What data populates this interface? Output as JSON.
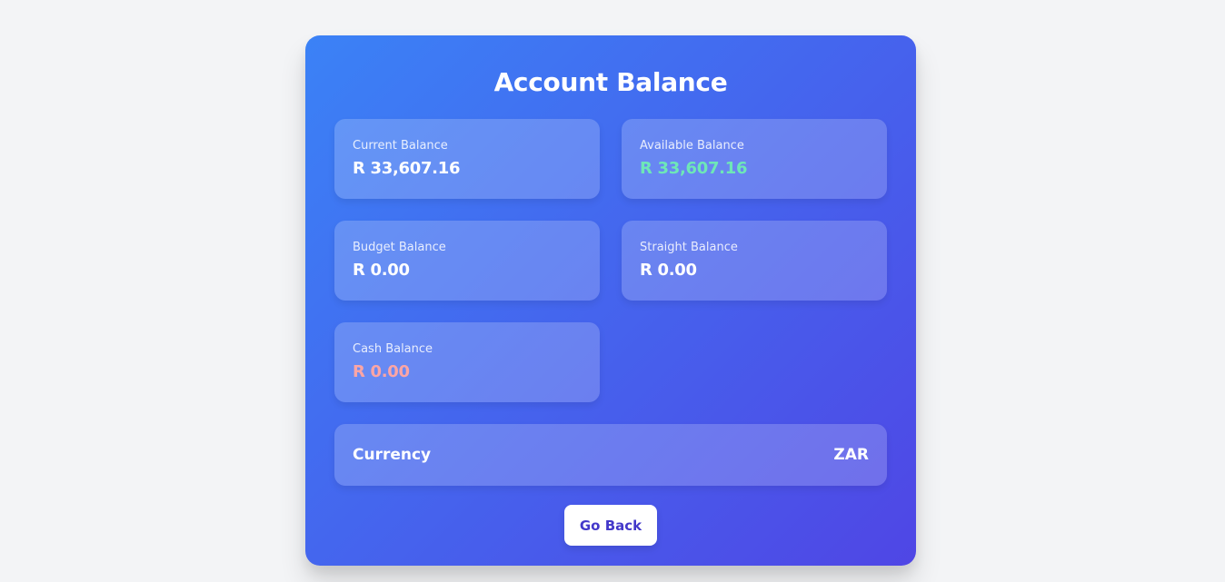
{
  "page": {
    "title": "Account Balance"
  },
  "balances": {
    "current": {
      "label": "Current Balance",
      "value": "R 33,607.16",
      "color": "#ffffff"
    },
    "available": {
      "label": "Available Balance",
      "value": "R 33,607.16",
      "color": "#6ee7b7"
    },
    "budget": {
      "label": "Budget Balance",
      "value": "R 0.00",
      "color": "#ffffff"
    },
    "straight": {
      "label": "Straight Balance",
      "value": "R 0.00",
      "color": "#ffffff"
    },
    "cash": {
      "label": "Cash Balance",
      "value": "R 0.00",
      "color": "#fca5a5"
    }
  },
  "currency": {
    "label": "Currency",
    "value": "ZAR"
  },
  "actions": {
    "back_label": "Go Back"
  },
  "theme": {
    "gradient_start": "#3b82f6",
    "gradient_end": "#4f46e5",
    "page_background": "#f3f4f6",
    "button_text": "#4338ca"
  }
}
